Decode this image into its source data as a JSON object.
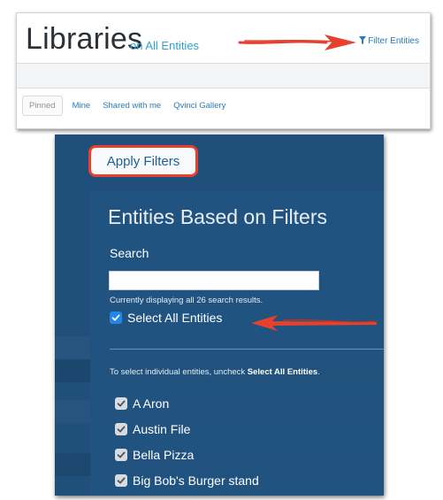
{
  "header": {
    "title": "Libraries",
    "subtitle": "on All Entities",
    "filter_link_label": "Filter Entities",
    "filter_icon": "funnel-icon",
    "annotation_arrow_color": "#e5412d"
  },
  "tabs": [
    {
      "label": "Pinned",
      "active": true
    },
    {
      "label": "Mine",
      "active": false
    },
    {
      "label": "Shared with me",
      "active": false
    },
    {
      "label": "Qvinci Gallery",
      "active": false
    }
  ],
  "filters": {
    "apply_button_label": "Apply Filters",
    "card_title": "Entities Based on Filters",
    "search_label": "Search",
    "search_value": "",
    "result_note": "Currently displaying all 26 search results.",
    "select_all_label": "Select All Entities",
    "select_all_checked": true,
    "instructions_prefix": "To select individual entities, uncheck ",
    "instructions_bold": "Select All Entities",
    "instructions_suffix": ".",
    "entities": [
      {
        "label": "A Aron",
        "checked": true
      },
      {
        "label": "Austin File",
        "checked": true
      },
      {
        "label": "Bella Pizza",
        "checked": true
      },
      {
        "label": "Big Bob's Burger stand",
        "checked": true
      }
    ]
  },
  "colors": {
    "panel_bg": "#1f4f7a",
    "card_bg": "#225480",
    "accent_blue": "#2a7ab9",
    "annotation_red": "#e5412d"
  }
}
